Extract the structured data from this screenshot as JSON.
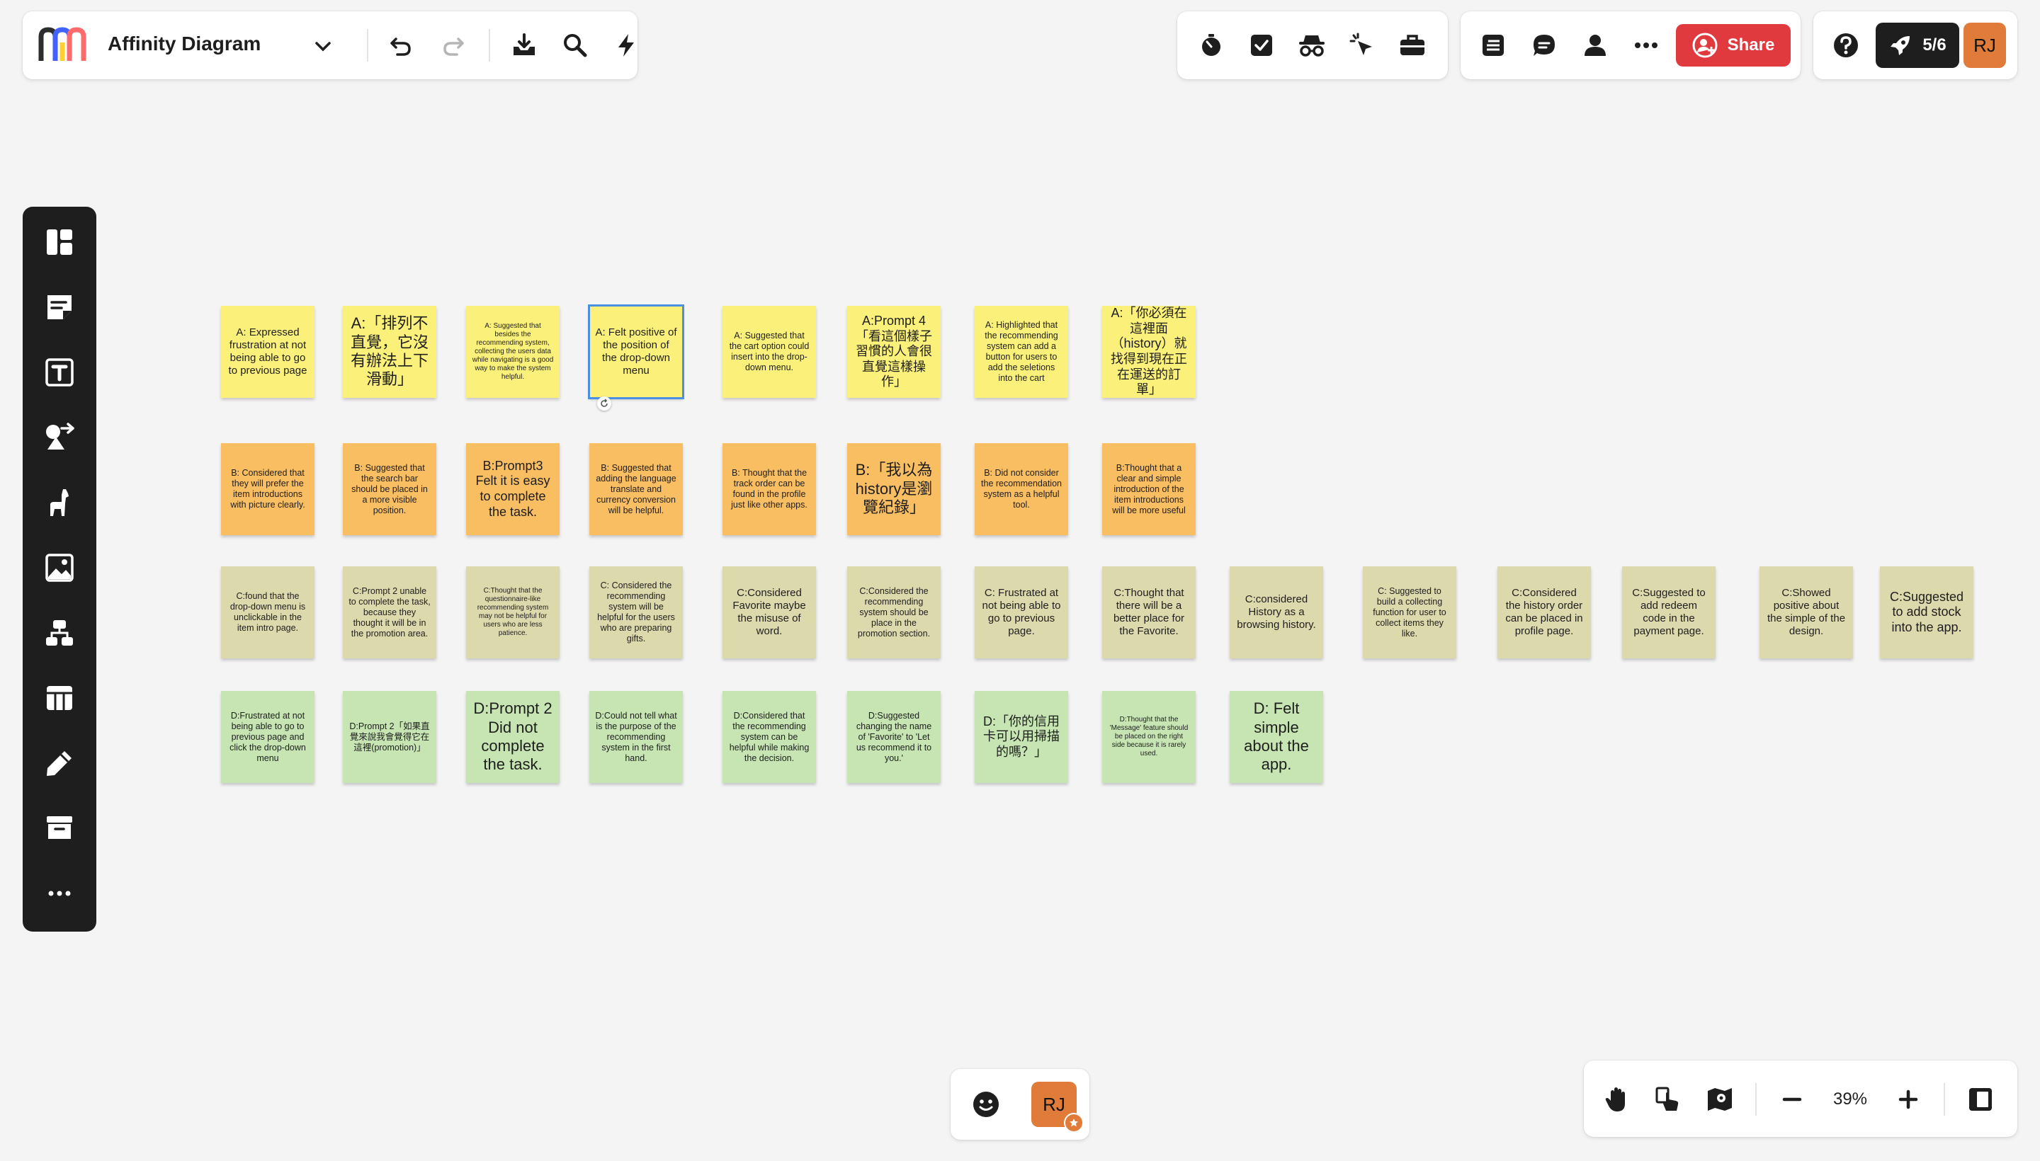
{
  "toolbar": {
    "board_title": "Affinity Diagram",
    "share_label": "Share",
    "launch_label": "5/6",
    "avatar_initials": "RJ"
  },
  "zoom": {
    "value": "39%"
  },
  "colors": {
    "yellow_note": "#fbf17a",
    "orange_note": "#f9bd62",
    "khaki_note": "#dcd9ad",
    "green_note": "#c6e5b2",
    "share_red": "#e0393e",
    "avatar_orange": "#e07b39"
  },
  "notes": {
    "a": [
      "A: Expressed frustration at not being able to go to previous page",
      "A:「排列不直覺，它沒有辦法上下滑動」",
      "A: Suggested that besides the recommending system, collecting the users data while navigating is a good way to make the system helpful.",
      "A: Felt positive of the position of the drop-down menu",
      "A: Suggested that the cart option could insert into the drop-down menu.",
      "A:Prompt 4「看這個樣子習慣的人會很直覺這樣操作」",
      "A: Highlighted that the recommending system can add a button for users to add the seletions into the cart",
      "A:「你必須在這裡面（history）就找得到現在正在運送的訂單」"
    ],
    "b": [
      "B: Considered that they will prefer the item introductions with picture clearly.",
      "B: Suggested that the search bar should be placed in a more visible position.",
      "B:Prompt3 Felt it is easy to complete the task.",
      "B: Suggested that adding the language translate and currency conversion will be helpful.",
      "B: Thought that the track order can be found in the profile just like other apps.",
      "B:「我以為history是瀏覽紀錄」",
      "B: Did not consider the recommendation system as a helpful tool.",
      "B:Thought that a clear and simple introduction of the item introductions will be more useful"
    ],
    "c": [
      "C:found that the drop-down menu is unclickable in the item intro page.",
      "C:Prompt 2 unable to complete the task, because they thought it will be in the promotion area.",
      "C:Thought that the questionnaire-like recommending system may not be helpful for users who are less patience.",
      "C: Considered the recommending system will be helpful for the users who are preparing gifts.",
      "C:Considered Favorite maybe the misuse of word.",
      "C:Considered the recommending system should be place in the promotion section.",
      "C: Frustrated at not being able to go to previous page.",
      "C:Thought that there will be a better place for the Favorite.",
      "C:considered History as a browsing history.",
      "C: Suggested to build a collecting function for user to collect items they like.",
      "C:Considered the history order can be placed in profile page.",
      "C:Suggested to add redeem code in the payment page.",
      "C:Showed positive about the simple of the design.",
      "C:Suggested to add stock into the app."
    ],
    "d": [
      "D:Frustrated at not being able to go to previous page and click the drop-down menu",
      "D:Prompt 2「如果直覺來說我會覺得它在這裡(promotion)」",
      "D:Prompt 2 Did not complete the task.",
      "D:Could not tell what is the purpose of the recommending system in the first hand.",
      "D:Considered that the recommending system can be helpful while making the decision.",
      "D:Suggested changing the name of 'Favorite' to 'Let us recommend it to you.'",
      "D:「你的信用卡可以用掃描的嗎？」",
      "D:Thought that the 'Message' feature should be placed on the right side because it is rarely used.",
      "D: Felt simple about the app."
    ]
  }
}
